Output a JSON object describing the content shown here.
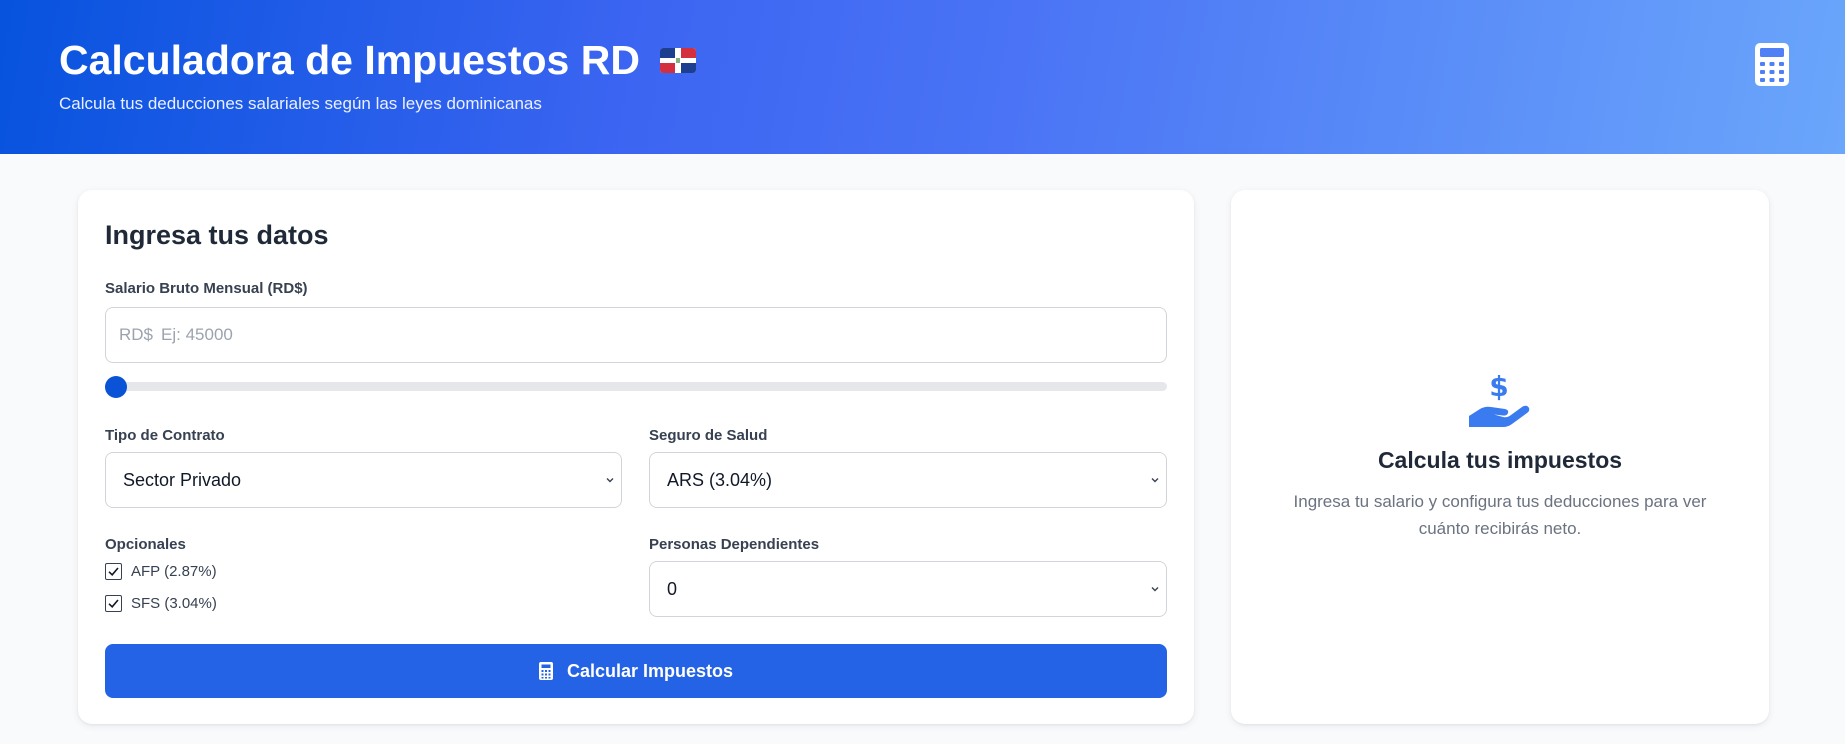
{
  "header": {
    "title": "Calculadora de Impuestos RD",
    "subtitle": "Calcula tus deducciones salariales según las leyes dominicanas",
    "flag_icon": "dominican-flag-icon",
    "calculator_icon": "calculator-icon"
  },
  "form": {
    "title": "Ingresa tus datos",
    "salary": {
      "label": "Salario Bruto Mensual (RD$)",
      "prefix": "RD$",
      "placeholder": "Ej: 45000",
      "value": ""
    },
    "slider": {
      "value_fraction": 0
    },
    "contract": {
      "label": "Tipo de Contrato",
      "selected": "Sector Privado"
    },
    "health": {
      "label": "Seguro de Salud",
      "selected": "ARS (3.04%)"
    },
    "optionals": {
      "label": "Opcionales",
      "items": [
        {
          "label": "AFP (2.87%)",
          "checked": true
        },
        {
          "label": "SFS (3.04%)",
          "checked": true
        }
      ]
    },
    "dependents": {
      "label": "Personas Dependientes",
      "selected": "0"
    },
    "button_label": "Calcular Impuestos"
  },
  "result": {
    "icon": "hand-holding-dollar-icon",
    "title": "Calcula tus impuestos",
    "text": "Ingresa tu salario y configura tus deducciones para ver cuánto recibirás neto."
  },
  "colors": {
    "accent": "#2463e6",
    "slider_thumb": "#0a52d6",
    "result_icon": "#3b7bf0"
  }
}
